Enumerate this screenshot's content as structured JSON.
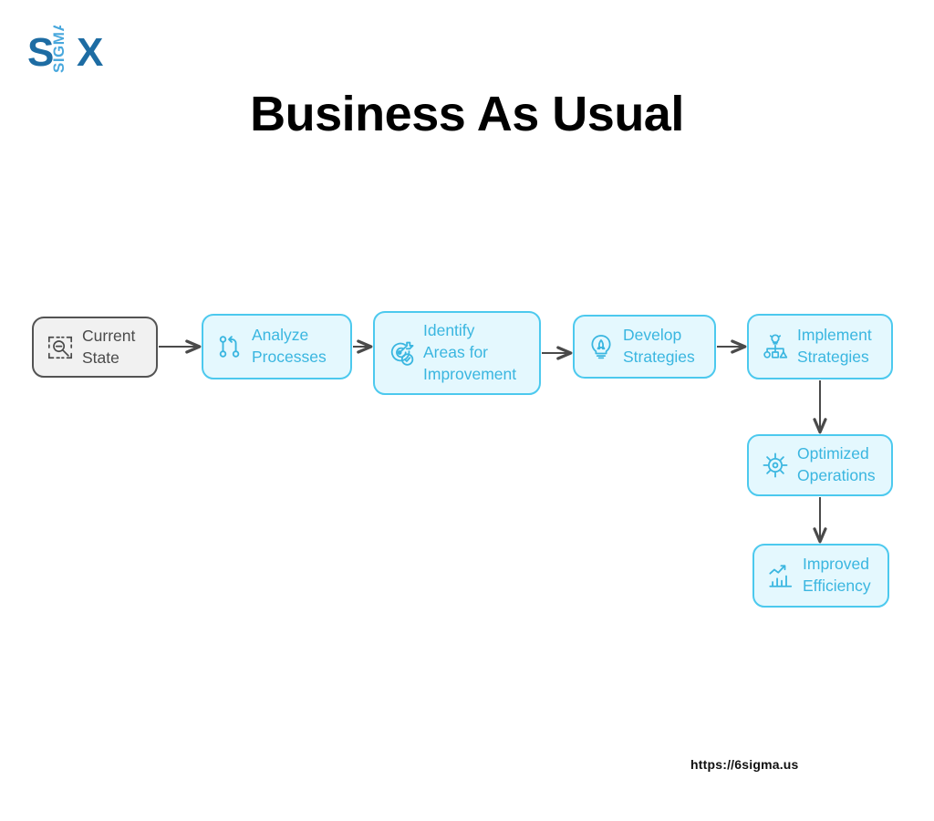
{
  "brand": {
    "logo_primary_text": "S",
    "logo_vertical_text": "SIGMA",
    "logo_suffix_text": "X",
    "logo_dark_color": "#1d6ca3",
    "logo_light_color": "#49a8dd"
  },
  "header": {
    "title": "Business As Usual"
  },
  "footer": {
    "url": "https://6sigma.us"
  },
  "theme": {
    "node_fill": "#e4f8fe",
    "node_border": "#4cc9ee",
    "node_text": "#3ab6e0",
    "start_fill": "#f1f1f1",
    "start_border": "#535353",
    "start_text": "#4a4a4a",
    "connector": "#4a4a4a",
    "page_bg": "#ffffff"
  },
  "diagram": {
    "type": "flowchart",
    "nodes": [
      {
        "id": "current-state",
        "label": "Current\nState",
        "icon": "zoom-out-scan-icon",
        "style": "start"
      },
      {
        "id": "analyze-processes",
        "label": "Analyze\nProcesses",
        "icon": "git-branch-icon",
        "style": "step"
      },
      {
        "id": "identify-areas",
        "label": "Identify\nAreas for\nImprovement",
        "icon": "target-check-icon",
        "style": "step"
      },
      {
        "id": "develop-strategies",
        "label": "Develop\nStrategies",
        "icon": "lightbulb-rocket-icon",
        "style": "step"
      },
      {
        "id": "implement-strategies",
        "label": "Implement\nStrategies",
        "icon": "hierarchy-idea-icon",
        "style": "step"
      },
      {
        "id": "optimized-operations",
        "label": "Optimized\nOperations",
        "icon": "gear-icon",
        "style": "step"
      },
      {
        "id": "improved-efficiency",
        "label": "Improved\nEfficiency",
        "icon": "bar-chart-growth-icon",
        "style": "step"
      }
    ],
    "edges": [
      {
        "from": "current-state",
        "to": "analyze-processes",
        "direction": "right"
      },
      {
        "from": "analyze-processes",
        "to": "identify-areas",
        "direction": "right"
      },
      {
        "from": "identify-areas",
        "to": "develop-strategies",
        "direction": "right"
      },
      {
        "from": "develop-strategies",
        "to": "implement-strategies",
        "direction": "right"
      },
      {
        "from": "implement-strategies",
        "to": "optimized-operations",
        "direction": "down"
      },
      {
        "from": "optimized-operations",
        "to": "improved-efficiency",
        "direction": "down"
      }
    ]
  }
}
